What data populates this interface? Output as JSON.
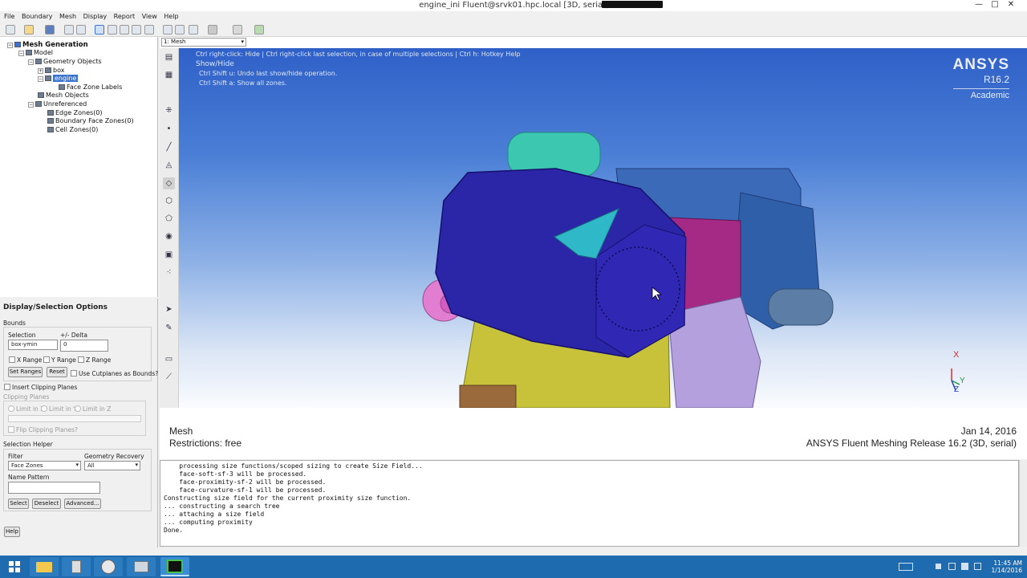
{
  "window": {
    "title": "engine_ini Fluent@srvk01.hpc.local  [3D, serial]",
    "minimize": "—",
    "maximize": "□",
    "close": "✕"
  },
  "menu": [
    "File",
    "Boundary",
    "Mesh",
    "Display",
    "Report",
    "View",
    "Help"
  ],
  "tree": {
    "root": "Mesh Generation",
    "model": "Model",
    "geometry_objects": "Geometry Objects",
    "box": "box",
    "engine": "engine",
    "face_zone_labels": "Face Zone Labels",
    "mesh_objects": "Mesh Objects",
    "unreferenced": "Unreferenced",
    "edge_zones": "Edge Zones(0)",
    "boundary_face_zones": "Boundary Face Zones(0)",
    "cell_zones": "Cell Zones(0)"
  },
  "options": {
    "title": "Display/Selection Options",
    "bounds": "Bounds",
    "selection_label": "Selection",
    "delta_label": "+/- Delta",
    "selection_value": "box-ymin",
    "delta_value": "0",
    "x_range": "X Range",
    "y_range": "Y Range",
    "z_range": "Z Range",
    "set_ranges": "Set Ranges",
    "reset": "Reset",
    "use_cutplanes": "Use Cutplanes as Bounds?",
    "insert_clipping": "Insert Clipping Planes",
    "clipping_planes": "Clipping Planes",
    "limit_x": "Limit in X",
    "limit_y": "Limit in Y",
    "limit_z": "Limit in Z",
    "flip_clipping": "Flip Clipping Planes?",
    "selection_helper": "Selection Helper",
    "filter_label": "Filter",
    "filter_value": "Face Zones",
    "geom_recovery_label": "Geometry Recovery",
    "geom_recovery_value": "All",
    "name_pattern": "Name Pattern",
    "name_pattern_value": "",
    "select": "Select",
    "deselect": "Deselect",
    "advanced": "Advanced...",
    "help": "Help"
  },
  "graphics": {
    "dropdown": "1: Mesh",
    "hint1": "Ctrl right-click: Hide | Ctrl right-click last selection, in case of multiple selections | Ctrl h: Hotkey Help",
    "hint2": "Show/Hide",
    "hint3": "Ctrl Shift u: Undo last show/hide operation.",
    "hint4": "Ctrl Shift a: Show all zones.",
    "brand": "ANSYS",
    "release": "R16.2",
    "edition": "Academic",
    "mesh_label": "Mesh",
    "restrictions": "Restrictions:  free",
    "date": "Jan 14, 2016",
    "product": "ANSYS Fluent Meshing Release 16.2 (3D, serial)",
    "axis_x": "X",
    "axis_y": "Y",
    "axis_z": "Z"
  },
  "console": [
    "    processing size functions/scoped sizing to create Size Field...",
    "    face-soft-sf-3 will be processed.",
    "    face-proximity-sf-2 will be processed.",
    "    face-curvature-sf-1 will be processed.",
    "Constructing size field for the current proximity size function.",
    "... constructing a search tree",
    "... attaching a size field",
    "... computing proximity",
    "Done."
  ],
  "taskbar": {
    "time": "11:45 AM",
    "date": "1/14/2016"
  },
  "colors": {
    "background_top": "#2f60c8",
    "taskbar": "#1f6bb0",
    "selection": "#3a74d0"
  }
}
